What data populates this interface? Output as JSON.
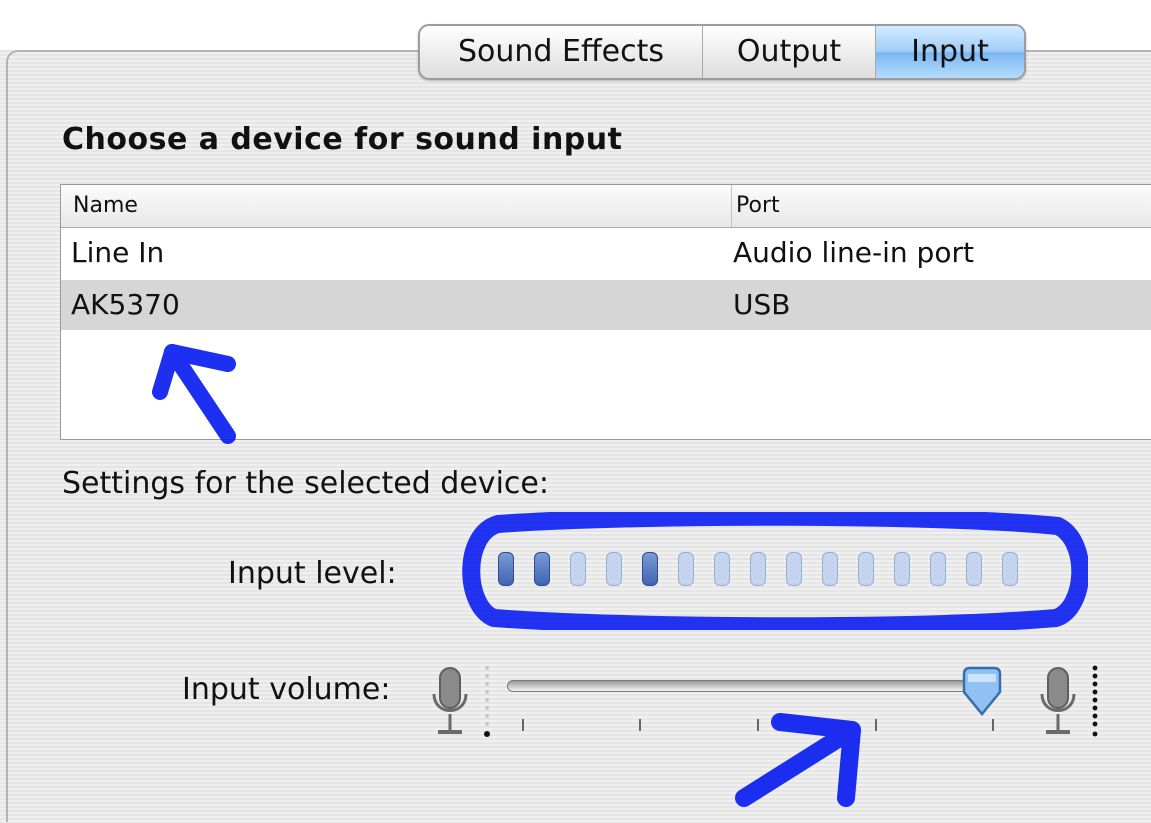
{
  "tabs": [
    {
      "label": "Sound Effects",
      "selected": false
    },
    {
      "label": "Output",
      "selected": false
    },
    {
      "label": "Input",
      "selected": true
    }
  ],
  "heading": "Choose a device for sound input",
  "table": {
    "columns": [
      "Name",
      "Port"
    ],
    "rows": [
      {
        "name": "Line In",
        "port": "Audio line-in port",
        "selected": false
      },
      {
        "name": "AK5370",
        "port": "USB",
        "selected": true
      }
    ]
  },
  "settings_label": "Settings for the selected device:",
  "input_level": {
    "label": "Input level:",
    "segments": 15,
    "lit_segments": [
      1,
      2,
      5
    ]
  },
  "input_volume": {
    "label": "Input volume:",
    "value_fraction": 0.97
  },
  "colors": {
    "selected_tab": "#9ecbf7",
    "selected_row": "#d6d6d6",
    "meter_on": "#3e64b4",
    "meter_off": "#c4d4ee",
    "annotation": "#0a1ef0"
  },
  "icons": [
    "microphone-icon",
    "microphone-loud-icon",
    "slider-thumb-icon"
  ]
}
